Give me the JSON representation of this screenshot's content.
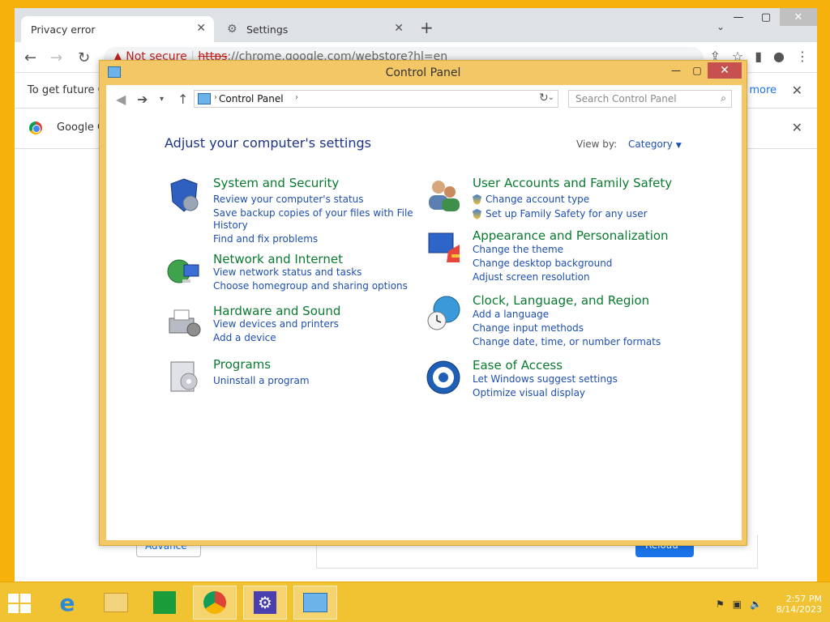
{
  "chrome": {
    "tab_active": "Privacy error",
    "tab_inactive": "Settings",
    "new_tab": "+",
    "url_warn": "Not secure",
    "url_https": "https",
    "url_rest": "://chrome.google.com/webstore?hl=en",
    "infobar_text": "To get future G",
    "infobar_learn": "n more",
    "infobar2_text": "Google C",
    "advanced_label": "Advance",
    "reload_label": "Reload"
  },
  "cp": {
    "title": "Control Panel",
    "address": "Control Panel",
    "search_placeholder": "Search Control Panel",
    "heading": "Adjust your computer's settings",
    "view_by_label": "View by:",
    "view_by_value": "Category",
    "categories": [
      {
        "title": "System and Security",
        "links": [
          "Review your computer's status",
          "Save backup copies of your files with File",
          "History",
          "Find and fix problems"
        ]
      },
      {
        "title": "Network and Internet",
        "links": [
          "View network status and tasks",
          "Choose homegroup and sharing options"
        ]
      },
      {
        "title": "Hardware and Sound",
        "links": [
          "View devices and printers",
          "Add a device"
        ]
      },
      {
        "title": "Programs",
        "links": [
          "Uninstall a program"
        ]
      },
      {
        "title": "User Accounts and Family Safety",
        "links": [
          "Change account type",
          "Set up Family Safety for any user"
        ]
      },
      {
        "title": "Appearance and Personalization",
        "links": [
          "Change the theme",
          "Change desktop background",
          "Adjust screen resolution"
        ]
      },
      {
        "title": "Clock, Language, and Region",
        "links": [
          "Add a language",
          "Change input methods",
          "Change date, time, or number formats"
        ]
      },
      {
        "title": "Ease of Access",
        "links": [
          "Let Windows suggest settings",
          "Optimize visual display"
        ]
      }
    ]
  },
  "taskbar": {
    "time": "2:57 PM",
    "date": "8/14/2023",
    "watermark": "(blurred)"
  }
}
